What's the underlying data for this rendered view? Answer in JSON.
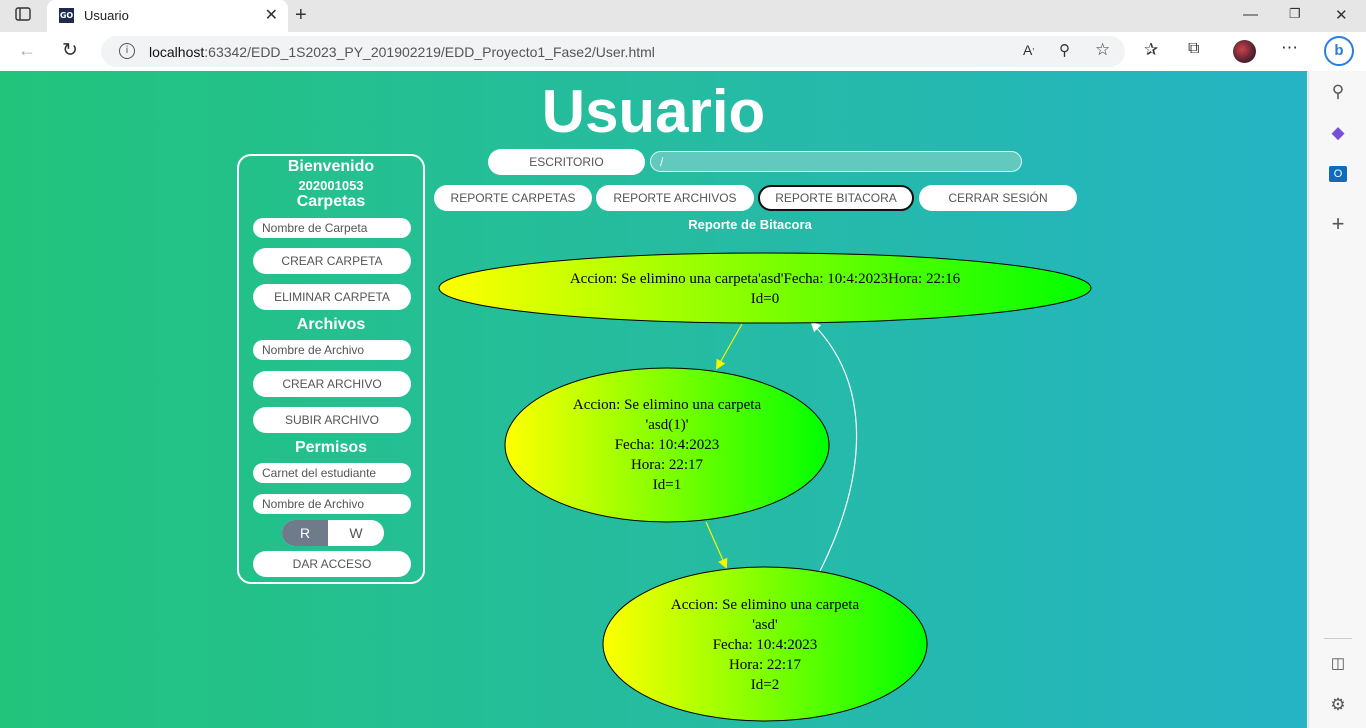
{
  "browser": {
    "tab_title": "Usuario",
    "tab_favicon": "GO",
    "url_host": "localhost",
    "url_rest": ":63342/EDD_1S2023_PY_201902219/EDD_Proyecto1_Fase2/User.html"
  },
  "page": {
    "title": "Usuario",
    "panel": {
      "welcome": "Bienvenido",
      "user_id": "202001053",
      "folders_heading": "Carpetas",
      "folder_name_placeholder": "Nombre de Carpeta",
      "create_folder": "CREAR CARPETA",
      "delete_folder": "ELIMINAR CARPETA",
      "files_heading": "Archivos",
      "file_name_placeholder": "Nombre de Archivo",
      "create_file": "CREAR ARCHIVO",
      "upload_file": "SUBIR ARCHIVO",
      "permissions_heading": "Permisos",
      "student_id_placeholder": "Carnet del estudiante",
      "perm_file_placeholder": "Nombre de Archivo",
      "perm_r": "R",
      "perm_w": "W",
      "grant_access": "DAR ACCESO"
    },
    "toolbar": {
      "desktop": "ESCRITORIO",
      "path": "/",
      "report_folders": "REPORTE CARPETAS",
      "report_files": "REPORTE ARCHIVOS",
      "report_log": "REPORTE BITACORA",
      "logout": "CERRAR SESIÓN"
    },
    "report_title": "Reporte de Bitacora",
    "graph": {
      "nodes": [
        {
          "lines": [
            "Accion: Se elimino una carpeta'asd'Fecha: 10:4:2023Hora: 22:16",
            "Id=0"
          ]
        },
        {
          "lines": [
            "Accion: Se elimino una carpeta",
            "'asd(1)'",
            "Fecha: 10:4:2023",
            "Hora: 22:17",
            "Id=1"
          ]
        },
        {
          "lines": [
            "Accion: Se elimino una carpeta",
            "'asd'",
            "Fecha: 10:4:2023",
            "Hora: 22:17",
            "Id=2"
          ]
        }
      ],
      "edge_color_forward": "#f5f500",
      "edge_color_back": "#ffffff",
      "node_gradient": [
        "#ffff00",
        "#00ff00"
      ]
    }
  }
}
